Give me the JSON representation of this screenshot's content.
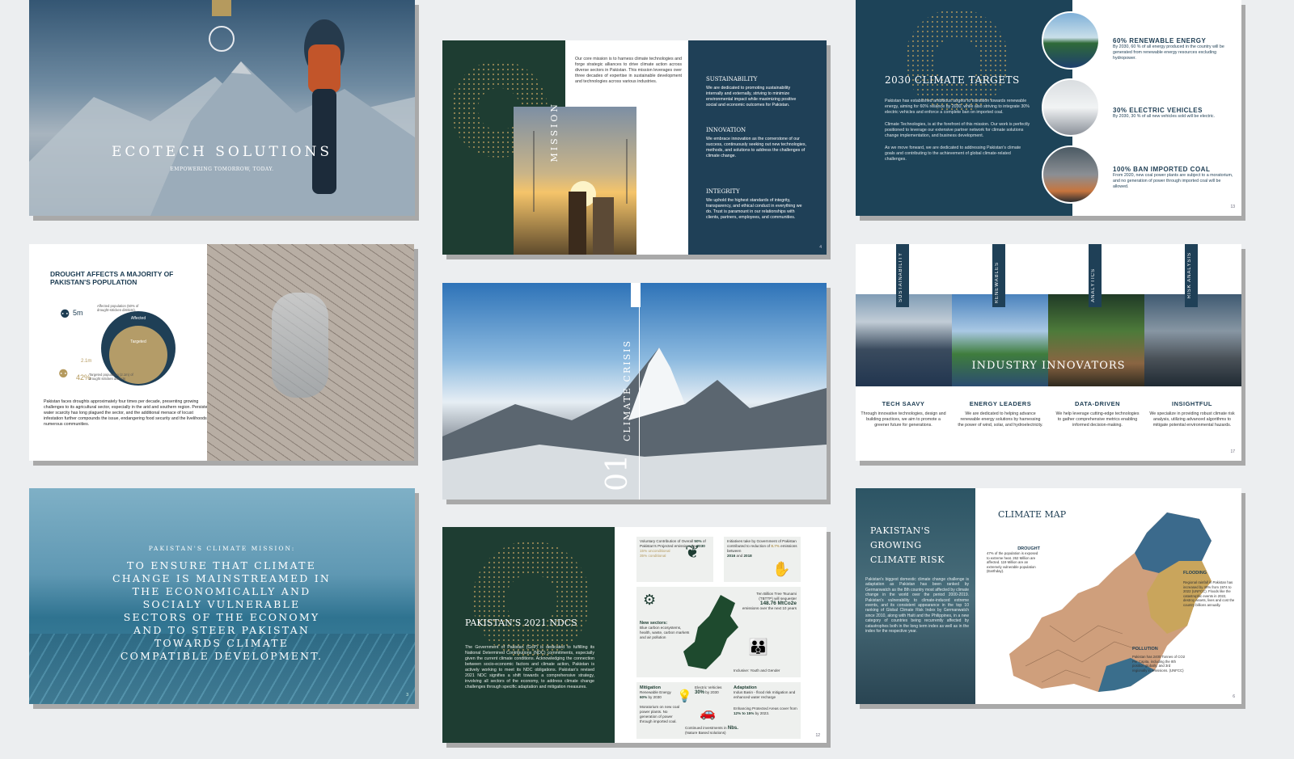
{
  "s1": {
    "title": "ECOTECH SOLUTIONS",
    "tagline": "EMPOWERING TOMORROW, TODAY."
  },
  "s2": {
    "mission_text": "Our core mission is to harness climate technologies and forge strategic alliances to drive climate action across diverse sectors in Pakistan. This mission leverages over three decades of expertise in sustainable development and technologies across various industries.",
    "side_label": "MISSION",
    "values": [
      {
        "title": "SUSTAINABILITY",
        "text": "We are dedicated to promoting sustainability internally and externally, striving to minimize environmental impact while maximizing positive social and economic outcomes for Pakistan."
      },
      {
        "title": "INNOVATION",
        "text": "We embrace innovation as the cornerstone of our success, continuously seeking out new technologies, methods, and solutions to address the challenges of climate change."
      },
      {
        "title": "INTEGRITY",
        "text": "We uphold the highest standards of integrity, transparency, and ethical conduct in everything we do. Trust is paramount in our relationships with clients, partners, employees, and communities."
      }
    ],
    "page": "4"
  },
  "s3": {
    "title": "2030 CLIMATE TARGETS",
    "paras": [
      "Pakistan has established ambitious targets to transition towards renewable energy, aiming for 60% reliance by 2030, while also striving to integrate 30% electric vehicles and enforce a complete ban on imported coal.",
      "Climate Technologies, is at the forefront of this mission. Our work is perfectly positioned to leverage our extensive partner network for climate solutions change implementation, and business development.",
      "As we move forward, we are dedicated to addressing Pakistan's climate goals and contributing to the achievement of global climate-related challenges."
    ],
    "targets": [
      {
        "title": "60% RENEWABLE ENERGY",
        "text": "By 2030, 60 % of all energy produced in the country will be generated from renewable energy resources excluding hydropower."
      },
      {
        "title": "30% ELECTRIC VEHICLES",
        "text": "By 2030, 30 % of all new vehicles sold will be electric."
      },
      {
        "title": "100% BAN IMPORTED COAL",
        "text": "From 2020, new coal power plants are subject to a moratorium, and no generation of power through imported coal will be allowed."
      }
    ],
    "page": "13"
  },
  "s4": {
    "title": "DROUGHT AFFECTS A MAJORITY OF PAKISTAN'S POPULATION",
    "stat1_value": "5m",
    "stat1_text": "Affected population (50% of drought-stricken districts).",
    "circle_outer": "Affected",
    "circle_inner": "Targeted",
    "stat2_value": "2.1m",
    "stat2_pct": "42%",
    "stat2_text": "Targeted population (2.1m) of drought stricken districts",
    "body": "Pakistan faces droughts approximately four times per decade, presenting growing challenges to its agricultural sector, especially in the arid and southern region. Persistent water scarcity has long plagued the sector, and the additional menace of locust infestation further compounds the issue, endangering food security and the livelihoods of numerous communities."
  },
  "s5": {
    "number": "01",
    "label": "CLIMATE CRISIS"
  },
  "s6": {
    "labels": [
      "SUSTAINABILITY",
      "RENEWABLES",
      "ANALYTICS",
      "RISK ANALYSIS"
    ],
    "overlay": "INDUSTRY INNOVATORS",
    "cols": [
      {
        "title": "TECH SAAVY",
        "text": "Through innovative technologies, design and building practices, we aim to promote a greener future for generations."
      },
      {
        "title": "ENERGY LEADERS",
        "text": "We are dedicated to helping advance renewable energy solutions by harnessing the power of wind, solar, and hydroelectricity."
      },
      {
        "title": "DATA-DRIVEN",
        "text": "We help leverage cutting-edge technologies to gather comprehensive metrics enabling informed decision-making."
      },
      {
        "title": "INSIGHTFUL",
        "text": "We specialize in providing robust climate risk analysis, utilizing advanced algorithms to mitigate potential environmental hazards."
      }
    ],
    "page": "17"
  },
  "s7": {
    "heading": "PAKISTAN'S CLIMATE MISSION:",
    "body": "TO ENSURE THAT CLIMATE CHANGE IS MAINSTREAMED IN THE ECONOMICALLY AND SOCIALY VULNERABLE SECTORS OF THE ECONOMY AND TO STEER PAKISTAN TOWARDS CLIMATE COMPATIBLE DEVELOPMENT.",
    "page": "3"
  },
  "s8": {
    "title": "PAKISTAN'S 2021 NDCS",
    "body": "The Government of Pakistan (GoP) is dedicated to fulfilling its National Determined Contributions (NDC) commitments, especially given the current climate conditions. Acknowledging the connection between socio-economic factors and climate action, Pakistan is actively working to meet its NDC obligations. Pakistan's revised 2021 NDC signifies a shift towards a comprehensive strategy, involving all sectors of the economy, to address climate change challenges through specific adaptation and mitigation measures.",
    "box1": {
      "l1": "Voluntary Contribution of Overall",
      "v1": "50%",
      "l2": "of Pakistan's Projected emissions by",
      "v2": "2030",
      "l3": "15% unconditional",
      "l4": "35% conditional"
    },
    "box2": {
      "l1": "Initiatives take by Government of Pakistan contributed to reduction of",
      "v1": "8.7%",
      "l2": "emissions between",
      "v2": "2016",
      "l3": "and",
      "v3": "2018"
    },
    "box3": {
      "tbt": "Ten Billion Tree Tsunami",
      "tbt_sub": "(TBTTP) will sequester",
      "value": "148.76 MtCo2e",
      "tbt_tail": "emissions over the next 10 years",
      "sectors_title": "New sectors:",
      "sectors": "Blue carbon ecosystems, health, waste, carbon markets and air pollution",
      "inclusive": "Inclusive: Youth and Gender"
    },
    "box4": {
      "mit_title": "Mitigation",
      "mit1": "Renewable Energy",
      "mit_v": "60%",
      "mit2": "by 2030",
      "mit3": "Moratorium on new coal power plants. No generation of power through imported coal.",
      "ev": "Electric Vehicles",
      "ev_v": "30%",
      "ev2": "by 2030",
      "ad_title": "Adaptation",
      "ad1": "Indus Basin - flood risk mitigation and enhanced water recharge",
      "ad2": "Enhancing Protected Areas cover from",
      "ad_v": "12% to 15%",
      "ad3": "by 2023.",
      "cont": "Continued investments in",
      "nbs": "Nbs.",
      "nbs_sub": "(Nature Based solutions)"
    },
    "page": "12"
  },
  "s9": {
    "left_title": "PAKISTAN'S GROWING CLIMATE RISK",
    "left_body": "Pakistan's biggest domestic climate change challenge is adaptation as Pakistan has been ranked by Germanwatch as the 8th country most affected by climate change in the world over the period 2000-2019. Pakistan's vulnerability to climate-induced extreme events, and its consistent appearance in the top 10 ranking of Global Climate Risk Index by Germanwatch since 2010, along with Haiti and the Philippines, in a new category of countries being recurrently affected by catastrophes both in the long term index as well as in the index for the respective year.",
    "map_title": "CLIMATE MAP",
    "drought_title": "DROUGHT",
    "drought_text": "47% of the population is exposed to extreme heat. 262 Million are affected. 119 Million are an extremely vulnerable population (Earthday).",
    "flood_title": "FLOODING",
    "flood_text": "Regional rainfall in Pakistan has increased by 40% from 1974 to 2022 (UNFCC). Floods like the catastrophic events in 2022, destroy assets, lives and cost the country billions annually.",
    "poll_title": "POLLUTION",
    "poll_text": "Pakistan has 2400 Tonnes of CO2 Per Capita, including the 8th position globally, and 3rd regionally in emissions. (UNFCC)",
    "page": "6"
  }
}
